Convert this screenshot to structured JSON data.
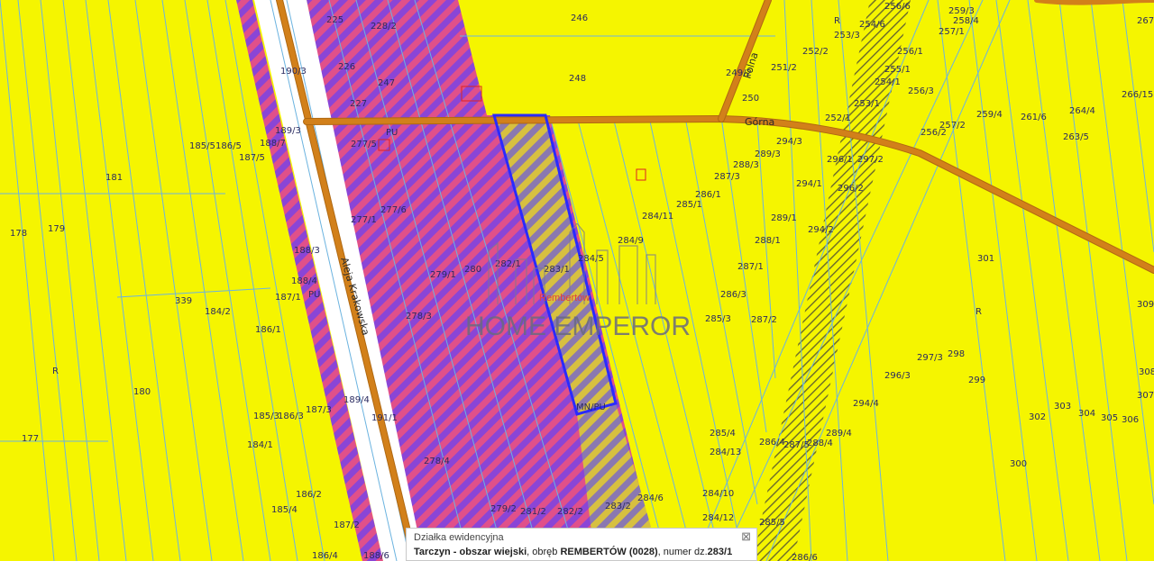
{
  "map": {
    "zones": {
      "residential_service": "MN/PU",
      "service_left": "PU",
      "service_top": "PU",
      "agricultural_left": "R",
      "agricultural_right": "R",
      "agricultural_top": "R"
    },
    "roads": {
      "aleja": "Aleja Krakowska",
      "gorna": "Górna",
      "polna": "Polna"
    },
    "colors": {
      "agricultural": "#f5f500",
      "service_hatch_a": "#e0508a",
      "service_hatch_b": "#8a45d6",
      "mnpu_hatch": "#8a78b0",
      "road": "#d2801a",
      "parcel_line": "#6bb3e0",
      "selected_outline": "#2a2aff"
    },
    "parcels": [
      "181",
      "178",
      "179",
      "339",
      "184/2",
      "180",
      "177",
      "185/5",
      "186/5",
      "187/5",
      "188/7",
      "189/3",
      "190/3",
      "188/3",
      "188/4",
      "187/1",
      "186/1",
      "185/3",
      "186/3",
      "187/3",
      "184/1",
      "189/4",
      "186/2",
      "185/4",
      "187/2",
      "186/4",
      "188/6",
      "225",
      "228/2",
      "226",
      "247",
      "227",
      "277/5",
      "277/6",
      "277/1",
      "279/1",
      "280",
      "282/1",
      "283/1",
      "278/3",
      "278/4",
      "279/2",
      "281/2",
      "282/2",
      "283/2",
      "191/1",
      "246",
      "248",
      "249/2",
      "250",
      "251/2",
      "252/2",
      "252/1",
      "253/3",
      "253/1",
      "254/6",
      "254/1",
      "255/1",
      "256/6",
      "256/1",
      "256/3",
      "256/2",
      "257/1",
      "257/2",
      "258/4",
      "259/3",
      "259/4",
      "261/6",
      "264/4",
      "263/5",
      "266/15",
      "267",
      "284/11",
      "284/9",
      "284/5",
      "285/1",
      "286/1",
      "287/3",
      "288/3",
      "289/3",
      "294/3",
      "296/1",
      "297/2",
      "296/2",
      "294/1",
      "289/1",
      "288/1",
      "287/1",
      "286/3",
      "285/3",
      "287/2",
      "294/2",
      "296/3",
      "297/3",
      "298",
      "299",
      "294/4",
      "289/4",
      "288/4",
      "287/5",
      "286/4",
      "284/13",
      "285/4",
      "284/10",
      "284/6",
      "284/12",
      "285/5",
      "286/6",
      "301",
      "302",
      "303",
      "304",
      "305",
      "306",
      "307",
      "308",
      "309",
      "300"
    ]
  },
  "watermark": {
    "brand": "HOME EMPEROR",
    "sub": "Rembertów"
  },
  "popup": {
    "title": "Działka ewidencyjna",
    "commune": "Tarczyn - obszar wiejski",
    "sep1": ", obręb ",
    "precinct": "REMBERTÓW (0028)",
    "sep2": ", numer dz.",
    "parcel_number": "283/1",
    "close": "⊠"
  }
}
